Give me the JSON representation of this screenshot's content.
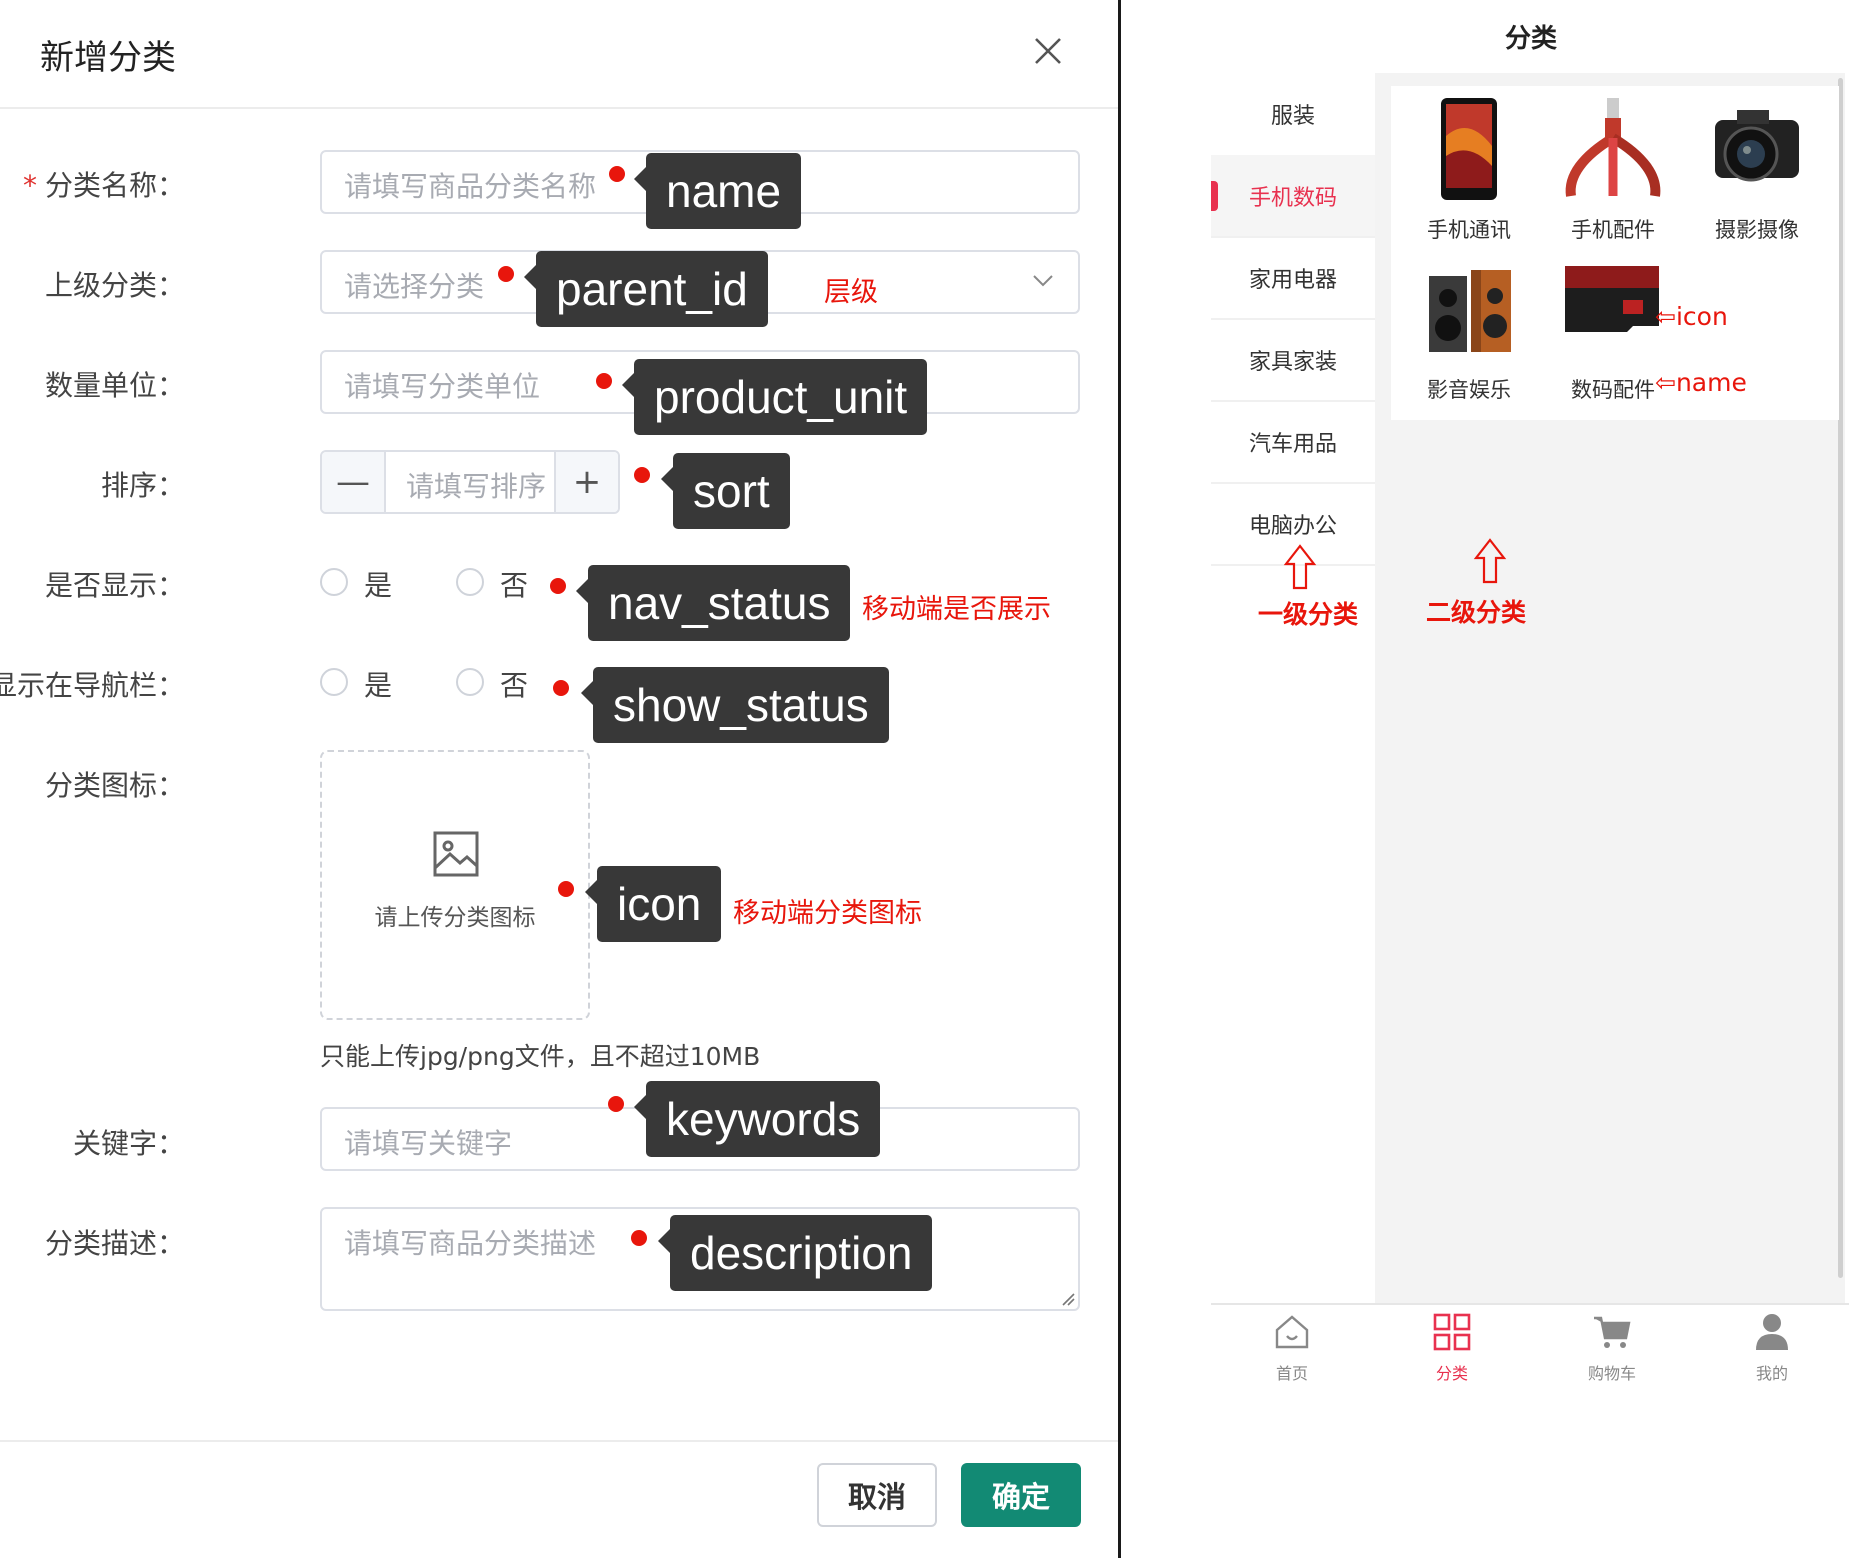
{
  "dialog": {
    "title": "新增分类",
    "fields": {
      "name": {
        "label": "分类名称：",
        "required_mark": "*",
        "placeholder": "请填写商品分类名称"
      },
      "parent": {
        "label": "上级分类：",
        "placeholder": "请选择分类"
      },
      "unit": {
        "label": "数量单位：",
        "placeholder": "请填写分类单位"
      },
      "sort": {
        "label": "排序：",
        "placeholder": "请填写排序",
        "minus": "—",
        "plus": "+"
      },
      "nav_status": {
        "label": "是否显示：",
        "yes": "是",
        "no": "否"
      },
      "show_status": {
        "label": "是否显示在导航栏：",
        "yes": "是",
        "no": "否"
      },
      "icon": {
        "label": "分类图标：",
        "upload_text": "请上传分类图标",
        "tip": "只能上传jpg/png文件，且不超过10MB"
      },
      "keywords": {
        "label": "关键字：",
        "placeholder": "请填写关键字"
      },
      "description": {
        "label": "分类描述：",
        "placeholder": "请填写商品分类描述"
      }
    },
    "buttons": {
      "cancel": "取消",
      "confirm": "确定"
    }
  },
  "annotations": {
    "tags": {
      "name": "name",
      "parent_id": "parent_id",
      "product_unit": "product_unit",
      "sort": "sort",
      "nav_status": "nav_status",
      "show_status": "show_status",
      "icon": "icon",
      "keywords": "keywords",
      "description": "description"
    },
    "notes": {
      "level": "层级",
      "nav_status": "移动端是否展示",
      "icon": "移动端分类图标",
      "mobile_icon": "icon",
      "mobile_name": "name",
      "level1": "一级分类",
      "level2": "二级分类"
    },
    "colors": {
      "tag_bg": "#383838",
      "note_red": "#e8160c"
    }
  },
  "mobile": {
    "title": "分类",
    "sidebar": [
      "服装",
      "手机数码",
      "家用电器",
      "家具家装",
      "汽车用品",
      "电脑办公"
    ],
    "active_sidebar": "手机数码",
    "subcategories": [
      {
        "name": "手机通讯",
        "icon": "phone-image"
      },
      {
        "name": "手机配件",
        "icon": "cable-image"
      },
      {
        "name": "摄影摄像",
        "icon": "camera-image"
      },
      {
        "name": "影音娱乐",
        "icon": "speaker-image"
      },
      {
        "name": "数码配件",
        "icon": "sd-card-image"
      }
    ],
    "tabs": [
      {
        "label": "首页",
        "icon": "home-icon"
      },
      {
        "label": "分类",
        "icon": "category-icon"
      },
      {
        "label": "购物车",
        "icon": "cart-icon"
      },
      {
        "label": "我的",
        "icon": "user-icon"
      }
    ],
    "active_tab": "分类",
    "accent_color": "#e8314f"
  },
  "theme": {
    "primary": "#128a74"
  }
}
